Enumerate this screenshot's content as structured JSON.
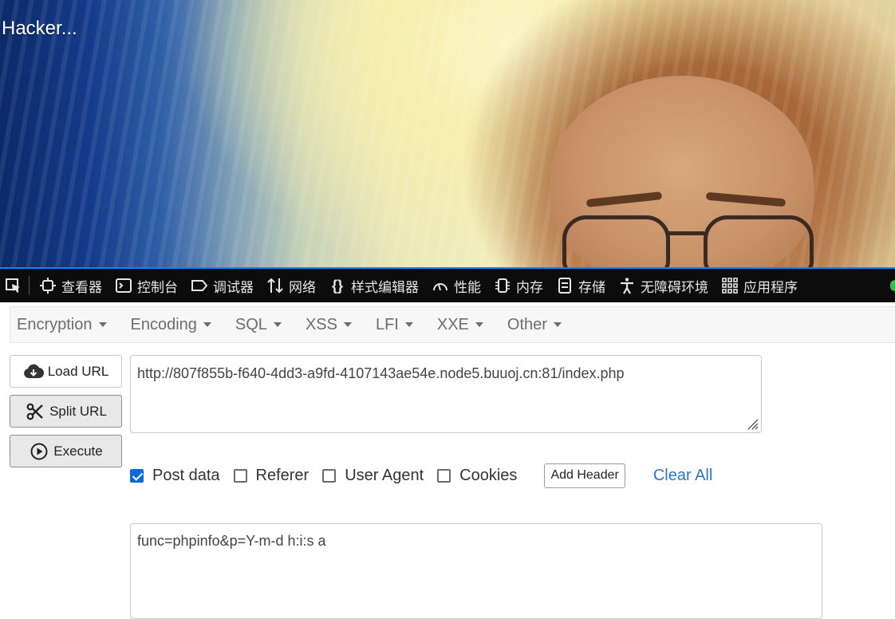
{
  "page": {
    "overlay_text": "Hacker..."
  },
  "devtools": {
    "tabs": [
      {
        "label": "查看器",
        "icon": "inspector-icon"
      },
      {
        "label": "控制台",
        "icon": "console-icon"
      },
      {
        "label": "调试器",
        "icon": "debugger-icon"
      },
      {
        "label": "网络",
        "icon": "network-icon"
      },
      {
        "label": "样式编辑器",
        "icon": "style-editor-icon"
      },
      {
        "label": "性能",
        "icon": "performance-icon"
      },
      {
        "label": "内存",
        "icon": "memory-icon"
      },
      {
        "label": "存储",
        "icon": "storage-icon"
      },
      {
        "label": "无障碍环境",
        "icon": "accessibility-icon"
      },
      {
        "label": "应用程序",
        "icon": "application-icon"
      }
    ]
  },
  "hackbar": {
    "menu": [
      {
        "label": "Encryption"
      },
      {
        "label": "Encoding"
      },
      {
        "label": "SQL"
      },
      {
        "label": "XSS"
      },
      {
        "label": "LFI"
      },
      {
        "label": "XXE"
      },
      {
        "label": "Other"
      }
    ],
    "buttons": {
      "load_url": "Load URL",
      "split_url": "Split URL",
      "execute": "Execute"
    },
    "url": "http://807f855b-f640-4dd3-a9fd-4107143ae54e.node5.buuoj.cn:81/index.php",
    "options": {
      "post_data": {
        "label": "Post data",
        "checked": true
      },
      "referer": {
        "label": "Referer",
        "checked": false
      },
      "user_agent": {
        "label": "User Agent",
        "checked": false
      },
      "cookies": {
        "label": "Cookies",
        "checked": false
      }
    },
    "add_header": "Add Header",
    "clear_all": "Clear All",
    "post_body": "func=phpinfo&p=Y-m-d h:i:s a"
  },
  "colors": {
    "devtools_bg": "#0c0c0d",
    "devtools_accent": "#0a84ff",
    "checkbox_checked": "#0b6bd6",
    "link": "#2a78c8"
  }
}
